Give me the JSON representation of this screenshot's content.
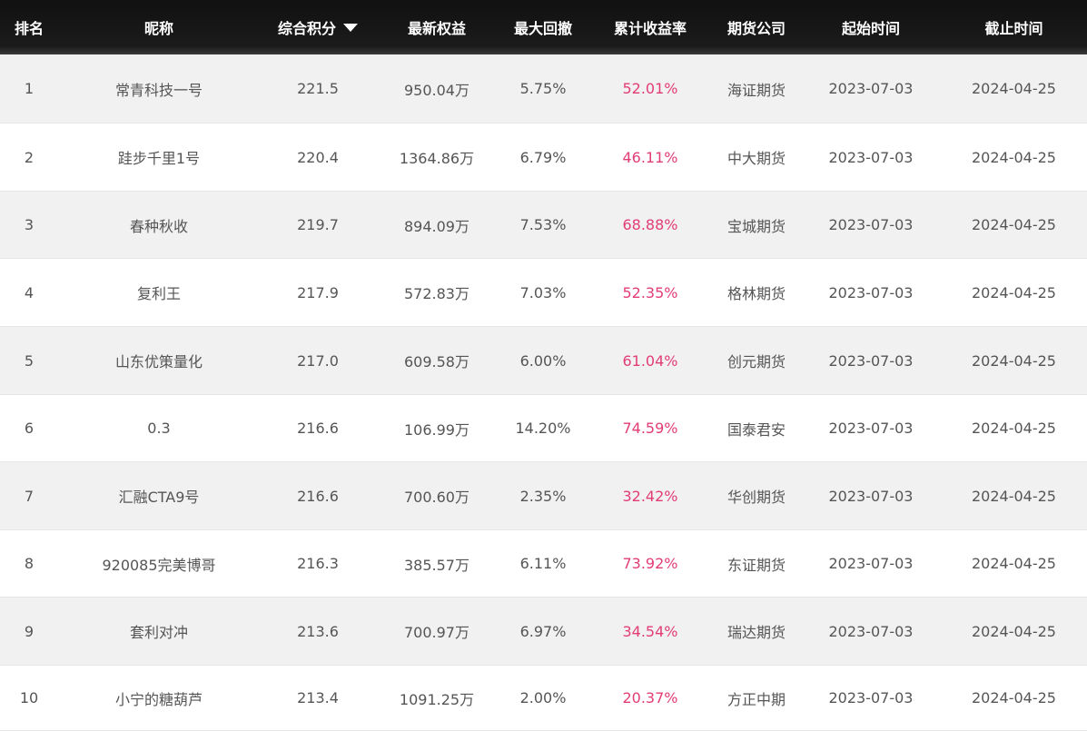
{
  "header": {
    "rank": "排名",
    "nickname": "昵称",
    "score": "综合积分",
    "equity": "最新权益",
    "drawdown": "最大回撤",
    "return_rate": "累计收益率",
    "broker": "期货公司",
    "start_date": "起始时间",
    "end_date": "截止时间",
    "sort_icon": "caret-down-icon"
  },
  "colors": {
    "header_bg": "#111111",
    "rate": "#e23c77",
    "odd_row": "#f1f1f1"
  },
  "rows": [
    {
      "rank": "1",
      "nickname": "常青科技一号",
      "score": "221.5",
      "equity": "950.04万",
      "drawdown": "5.75%",
      "return_rate": "52.01%",
      "broker": "海证期货",
      "start": "2023-07-03",
      "end": "2024-04-25"
    },
    {
      "rank": "2",
      "nickname": "跬步千里1号",
      "score": "220.4",
      "equity": "1364.86万",
      "drawdown": "6.79%",
      "return_rate": "46.11%",
      "broker": "中大期货",
      "start": "2023-07-03",
      "end": "2024-04-25"
    },
    {
      "rank": "3",
      "nickname": "春种秋收",
      "score": "219.7",
      "equity": "894.09万",
      "drawdown": "7.53%",
      "return_rate": "68.88%",
      "broker": "宝城期货",
      "start": "2023-07-03",
      "end": "2024-04-25"
    },
    {
      "rank": "4",
      "nickname": "复利王",
      "score": "217.9",
      "equity": "572.83万",
      "drawdown": "7.03%",
      "return_rate": "52.35%",
      "broker": "格林期货",
      "start": "2023-07-03",
      "end": "2024-04-25"
    },
    {
      "rank": "5",
      "nickname": "山东优策量化",
      "score": "217.0",
      "equity": "609.58万",
      "drawdown": "6.00%",
      "return_rate": "61.04%",
      "broker": "创元期货",
      "start": "2023-07-03",
      "end": "2024-04-25"
    },
    {
      "rank": "6",
      "nickname": "0.3",
      "score": "216.6",
      "equity": "106.99万",
      "drawdown": "14.20%",
      "return_rate": "74.59%",
      "broker": "国泰君安",
      "start": "2023-07-03",
      "end": "2024-04-25"
    },
    {
      "rank": "7",
      "nickname": "汇融CTA9号",
      "score": "216.6",
      "equity": "700.60万",
      "drawdown": "2.35%",
      "return_rate": "32.42%",
      "broker": "华创期货",
      "start": "2023-07-03",
      "end": "2024-04-25"
    },
    {
      "rank": "8",
      "nickname": "920085完美博哥",
      "score": "216.3",
      "equity": "385.57万",
      "drawdown": "6.11%",
      "return_rate": "73.92%",
      "broker": "东证期货",
      "start": "2023-07-03",
      "end": "2024-04-25"
    },
    {
      "rank": "9",
      "nickname": "套利对冲",
      "score": "213.6",
      "equity": "700.97万",
      "drawdown": "6.97%",
      "return_rate": "34.54%",
      "broker": "瑞达期货",
      "start": "2023-07-03",
      "end": "2024-04-25"
    },
    {
      "rank": "10",
      "nickname": "小宁的糖葫芦",
      "score": "213.4",
      "equity": "1091.25万",
      "drawdown": "2.00%",
      "return_rate": "20.37%",
      "broker": "方正中期",
      "start": "2023-07-03",
      "end": "2024-04-25"
    }
  ]
}
